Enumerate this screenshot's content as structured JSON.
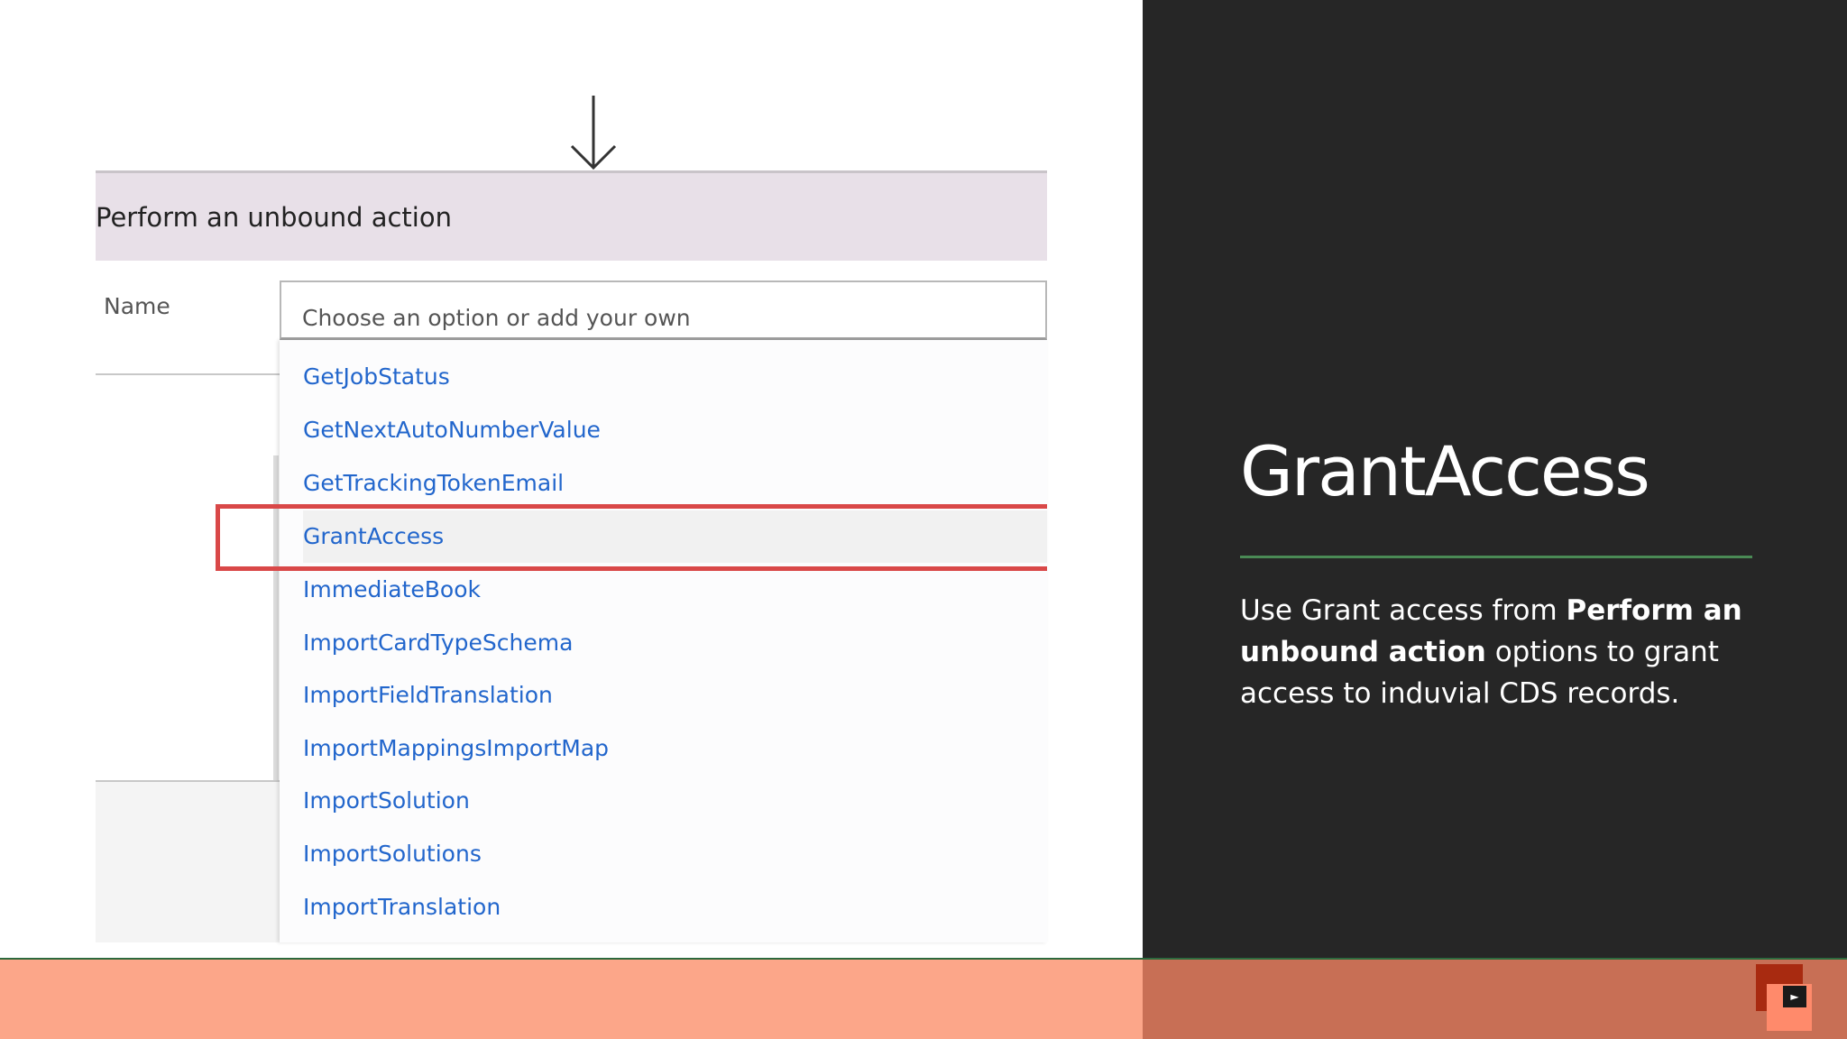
{
  "diagram": {
    "action_title": "Perform an unbound action",
    "name_label": "Name",
    "combo_placeholder": "Choose an option or add your own",
    "options": [
      {
        "label": "GetJobStatus"
      },
      {
        "label": "GetNextAutoNumberValue"
      },
      {
        "label": "GetTrackingTokenEmail"
      },
      {
        "label": "GrantAccess",
        "selected": true
      },
      {
        "label": "ImmediateBook"
      },
      {
        "label": "ImportCardTypeSchema"
      },
      {
        "label": "ImportFieldTranslation"
      },
      {
        "label": "ImportMappingsImportMap"
      },
      {
        "label": "ImportSolution"
      },
      {
        "label": "ImportSolutions"
      },
      {
        "label": "ImportTranslation"
      }
    ]
  },
  "slide": {
    "title": "GrantAccess",
    "body_pre": "Use Grant access from ",
    "body_bold": "Perform an unbound action",
    "body_post": " options to grant access to induvial CDS records."
  },
  "colors": {
    "accent_rule": "#4a8a55",
    "highlight": "#d94848",
    "link": "#2266cc",
    "dark_panel": "#262626",
    "bar_left": "#fca689",
    "bar_right": "#c86f55"
  },
  "icons": {
    "arrow": "arrow-down-icon",
    "play": "play-icon"
  }
}
